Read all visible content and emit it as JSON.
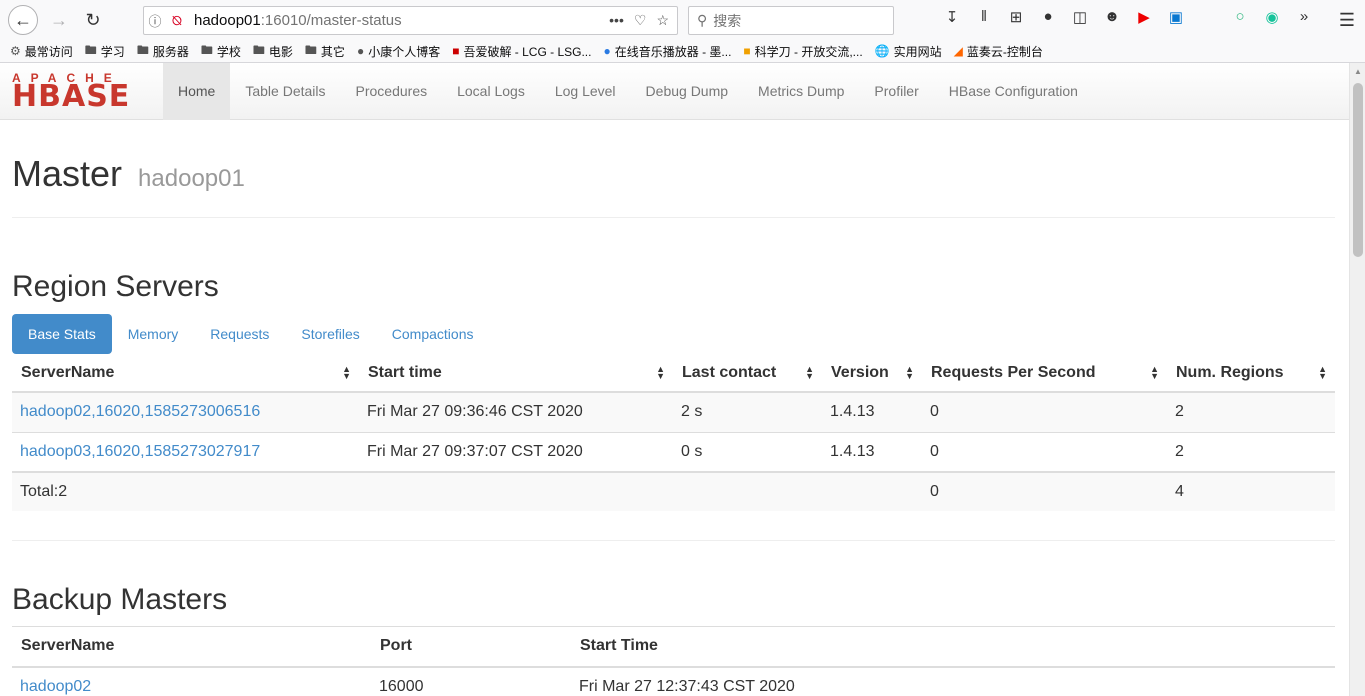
{
  "browser": {
    "url_host": "hadoop01",
    "url_rest": ":16010/master-status",
    "search_placeholder": "搜索"
  },
  "bookmarks": [
    {
      "label": "最常访问",
      "icon": "gear-icon"
    },
    {
      "label": "学习",
      "icon": "folder-icon"
    },
    {
      "label": "服务器",
      "icon": "folder-icon"
    },
    {
      "label": "学校",
      "icon": "folder-icon"
    },
    {
      "label": "电影",
      "icon": "folder-icon"
    },
    {
      "label": "其它",
      "icon": "folder-icon"
    },
    {
      "label": "小康个人博客",
      "icon": "site-icon"
    },
    {
      "label": "吾爱破解 - LCG - LSG...",
      "icon": "site-icon"
    },
    {
      "label": "在线音乐播放器 - 墨...",
      "icon": "site-icon"
    },
    {
      "label": "科学刀 - 开放交流,...",
      "icon": "site-icon"
    },
    {
      "label": "实用网站",
      "icon": "globe-icon"
    },
    {
      "label": "蓝奏云-控制台",
      "icon": "site-icon"
    }
  ],
  "logo": {
    "top": "APACHE",
    "main": "HBASE"
  },
  "nav": [
    "Home",
    "Table Details",
    "Procedures",
    "Local Logs",
    "Log Level",
    "Debug Dump",
    "Metrics Dump",
    "Profiler",
    "HBase Configuration"
  ],
  "master": {
    "title": "Master",
    "host": "hadoop01"
  },
  "region_servers": {
    "title": "Region Servers",
    "tabs": [
      "Base Stats",
      "Memory",
      "Requests",
      "Storefiles",
      "Compactions"
    ],
    "headers": [
      "ServerName",
      "Start time",
      "Last contact",
      "Version",
      "Requests Per Second",
      "Num. Regions"
    ],
    "rows": [
      [
        "hadoop02,16020,1585273006516",
        "Fri Mar 27 09:36:46 CST 2020",
        "2 s",
        "1.4.13",
        "0",
        "2"
      ],
      [
        "hadoop03,16020,1585273027917",
        "Fri Mar 27 09:37:07 CST 2020",
        "0 s",
        "1.4.13",
        "0",
        "2"
      ]
    ],
    "total": {
      "label": "Total:2",
      "requests": "0",
      "regions": "4"
    }
  },
  "backup_masters": {
    "title": "Backup Masters",
    "headers": [
      "ServerName",
      "Port",
      "Start Time"
    ],
    "rows": [
      [
        "hadoop02",
        "16000",
        "Fri Mar 27 12:37:43 CST 2020"
      ]
    ]
  }
}
